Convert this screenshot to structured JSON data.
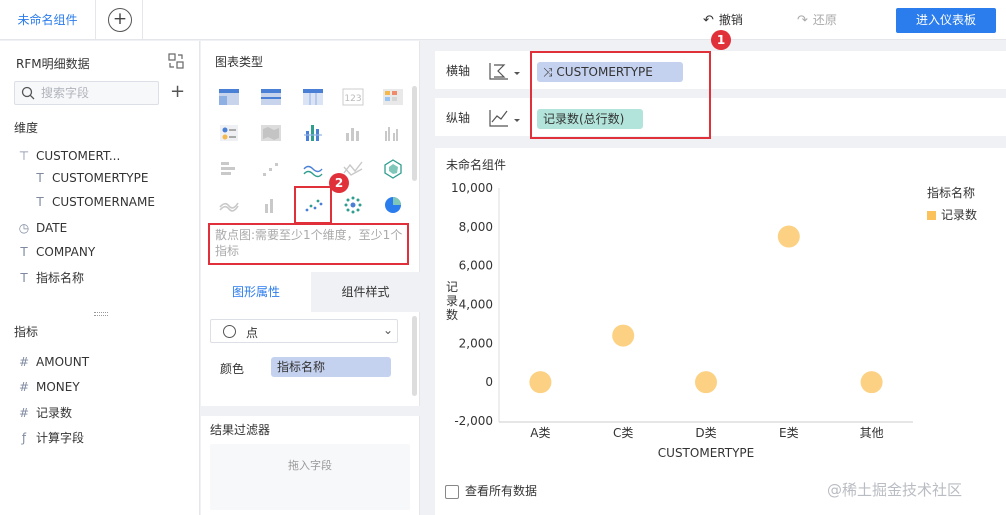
{
  "topbar": {
    "tab_label": "未命名组件",
    "undo_label": "撤销",
    "redo_label": "还原",
    "enter_dashboard_label": "进入仪表板"
  },
  "left_panel": {
    "dataset_title": "RFM明细数据",
    "search_placeholder": "搜索字段",
    "dimensions_label": "维度",
    "dimension_group": "CUSTOMERT...",
    "dimension_group_children": [
      "CUSTOMERTYPE",
      "CUSTOMERNAME"
    ],
    "dimension_fields": [
      {
        "label": "DATE",
        "icon": "clock-icon"
      },
      {
        "label": "COMPANY",
        "icon": "text-type-icon"
      },
      {
        "label": "指标名称",
        "icon": "text-type-icon"
      }
    ],
    "measures_label": "指标",
    "measure_fields": [
      {
        "label": "AMOUNT",
        "icon": "hash-icon"
      },
      {
        "label": "MONEY",
        "icon": "hash-icon"
      },
      {
        "label": "记录数",
        "icon": "hash-icon"
      },
      {
        "label": "计算字段",
        "icon": "formula-icon"
      }
    ]
  },
  "mid_panel": {
    "chart_type_title": "图表类型",
    "selected_chart_type": "scatter",
    "hint": "散点图:需要至少1个维度，至少1个指标",
    "tab_graphic": "图形属性",
    "tab_style": "组件样式",
    "shape_value": "点",
    "color_label": "颜色",
    "color_field": "指标名称",
    "filter_title": "结果过滤器",
    "drop_hint": "拖入字段",
    "badge_2": "2"
  },
  "axes": {
    "x_label": "横轴",
    "x_field": "CUSTOMERTYPE",
    "y_label": "纵轴",
    "y_field": "记录数(总行数)",
    "badge_1": "1"
  },
  "chart": {
    "title": "未命名组件",
    "legend_title": "指标名称",
    "legend_item": "记录数",
    "view_all_label": "查看所有数据",
    "point_color": "#fbc15a"
  },
  "chart_data": {
    "type": "scatter",
    "categories": [
      "A类",
      "C类",
      "D类",
      "E类",
      "其他"
    ],
    "series": [
      {
        "name": "记录数",
        "values": [
          0,
          2400,
          0,
          7500,
          0
        ]
      }
    ],
    "xlabel": "CUSTOMERTYPE",
    "ylabel": "记录数",
    "ylim": [
      -2000,
      10000
    ],
    "yticks": [
      "10,000",
      "8,000",
      "6,000",
      "4,000",
      "2,000",
      "0",
      "-2,000"
    ],
    "ytick_values": [
      10000,
      8000,
      6000,
      4000,
      2000,
      0,
      -2000
    ],
    "legend": "top-right"
  },
  "watermark": "@稀土掘金技术社区"
}
